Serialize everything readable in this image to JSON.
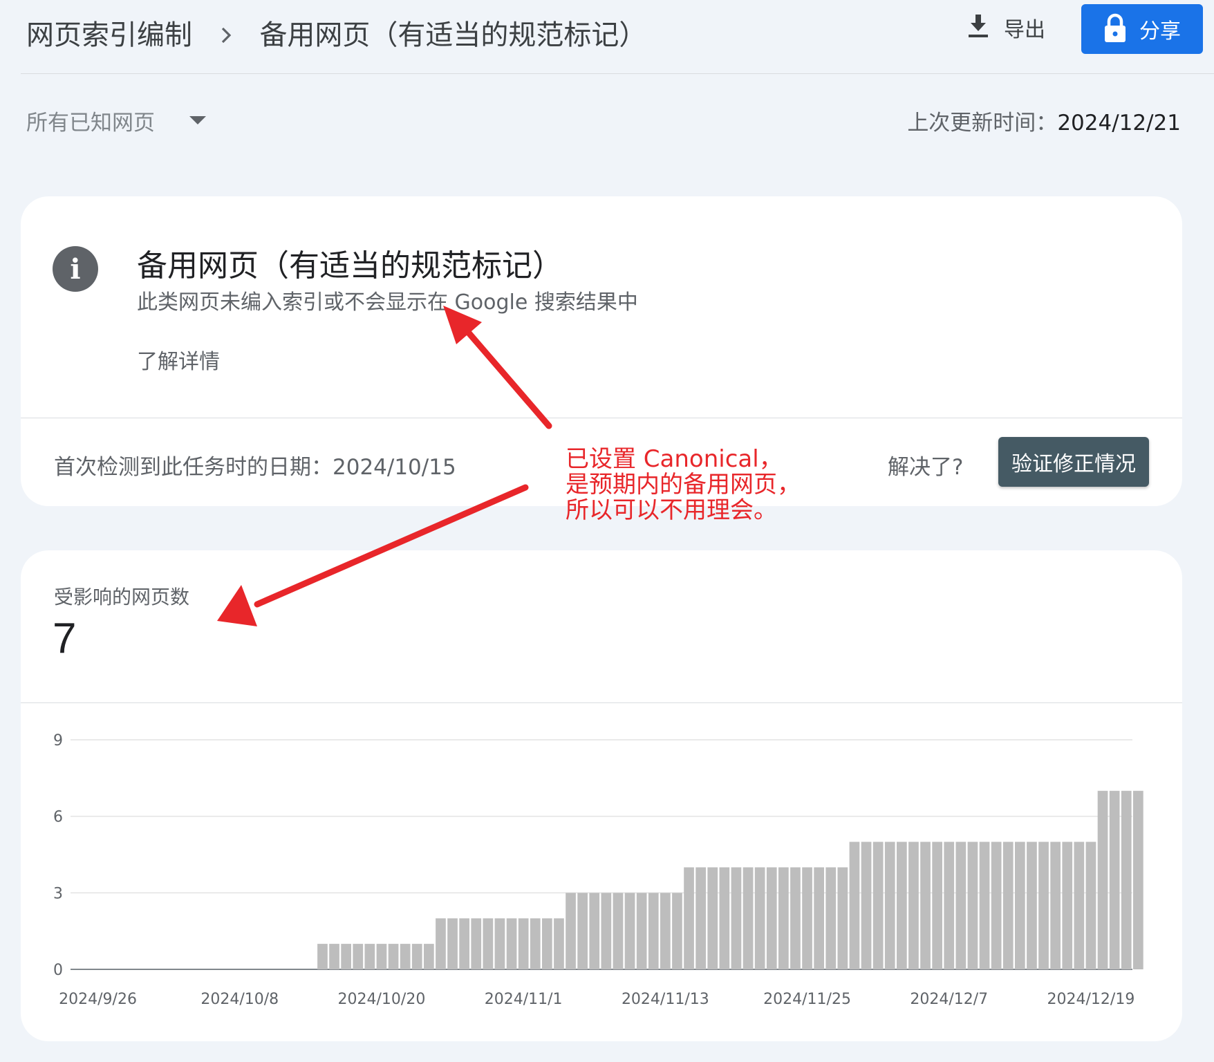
{
  "header": {
    "breadcrumb_root": "网页索引编制",
    "breadcrumb_current": "备用网页（有适当的规范标记）",
    "export_label": "导出",
    "share_label": "分享"
  },
  "filter": {
    "selected": "所有已知网页"
  },
  "last_updated": {
    "label": "上次更新时间：",
    "value": "2024/12/21"
  },
  "issue": {
    "title": "备用网页（有适当的规范标记）",
    "description": "此类网页未编入索引或不会显示在 Google 搜索结果中",
    "learn_more": "了解详情",
    "first_detected_label": "首次检测到此任务时的日期：",
    "first_detected_value": "2024/10/15",
    "resolved_question": "解决了?",
    "validate_button": "验证修正情况"
  },
  "annotation": {
    "lines": [
      "已设置 Canonical，",
      "是预期内的备用网页，",
      "所以可以不用理会。"
    ],
    "color": "#e8262a"
  },
  "affected": {
    "label": "受影响的网页数",
    "value": "7"
  },
  "colors": {
    "accent": "#1a73e8",
    "validate_button": "#455a64",
    "bar": "#bdbdbd"
  },
  "chart_data": {
    "type": "bar",
    "ylim": [
      0,
      9
    ],
    "yticks": [
      "0",
      "3",
      "6",
      "9"
    ],
    "x_tick_labels": [
      "2024/9/26",
      "2024/10/8",
      "2024/10/20",
      "2024/11/1",
      "2024/11/13",
      "2024/11/25",
      "2024/12/7",
      "2024/12/19"
    ],
    "grid": true,
    "start_date": "2024/9/26",
    "values": [
      0,
      0,
      0,
      0,
      0,
      0,
      0,
      0,
      0,
      0,
      0,
      0,
      0,
      0,
      0,
      0,
      0,
      0,
      0,
      1,
      1,
      1,
      1,
      1,
      1,
      1,
      1,
      1,
      1,
      2,
      2,
      2,
      2,
      2,
      2,
      2,
      2,
      2,
      2,
      2,
      3,
      3,
      3,
      3,
      3,
      3,
      3,
      3,
      3,
      3,
      4,
      4,
      4,
      4,
      4,
      4,
      4,
      4,
      4,
      4,
      4,
      4,
      4,
      4,
      5,
      5,
      5,
      5,
      5,
      5,
      5,
      5,
      5,
      5,
      5,
      5,
      5,
      5,
      5,
      5,
      5,
      5,
      5,
      5,
      5,
      7,
      7,
      7,
      7
    ]
  }
}
